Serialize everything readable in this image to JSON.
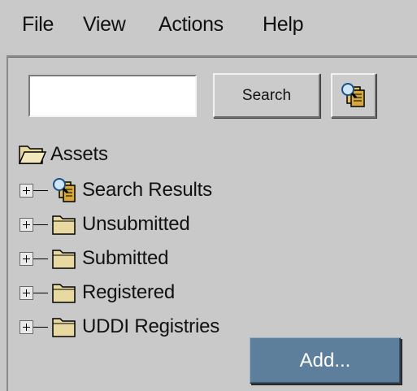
{
  "menubar": {
    "items": [
      {
        "label": "File"
      },
      {
        "label": "View"
      },
      {
        "label": "Actions"
      },
      {
        "label": "Help"
      }
    ]
  },
  "search": {
    "value": "",
    "placeholder": "",
    "button_label": "Search"
  },
  "toolbar": {
    "query_icon": "query-document-icon"
  },
  "tree": {
    "root": {
      "label": "Assets",
      "icon": "open-folder-icon"
    },
    "children": [
      {
        "label": "Search Results",
        "icon": "query-document-icon",
        "expanded": false
      },
      {
        "label": "Unsubmitted",
        "icon": "folder-icon",
        "expanded": false
      },
      {
        "label": "Submitted",
        "icon": "folder-icon",
        "expanded": false
      },
      {
        "label": "Registered",
        "icon": "folder-icon",
        "expanded": false
      },
      {
        "label": "UDDI Registries",
        "icon": "folder-icon",
        "expanded": false
      }
    ]
  },
  "context_menu": {
    "label": "Add..."
  },
  "colors": {
    "background": "#c8c8c8",
    "menu_highlight": "#5d7f9c",
    "folder": "#e8d9a0"
  }
}
